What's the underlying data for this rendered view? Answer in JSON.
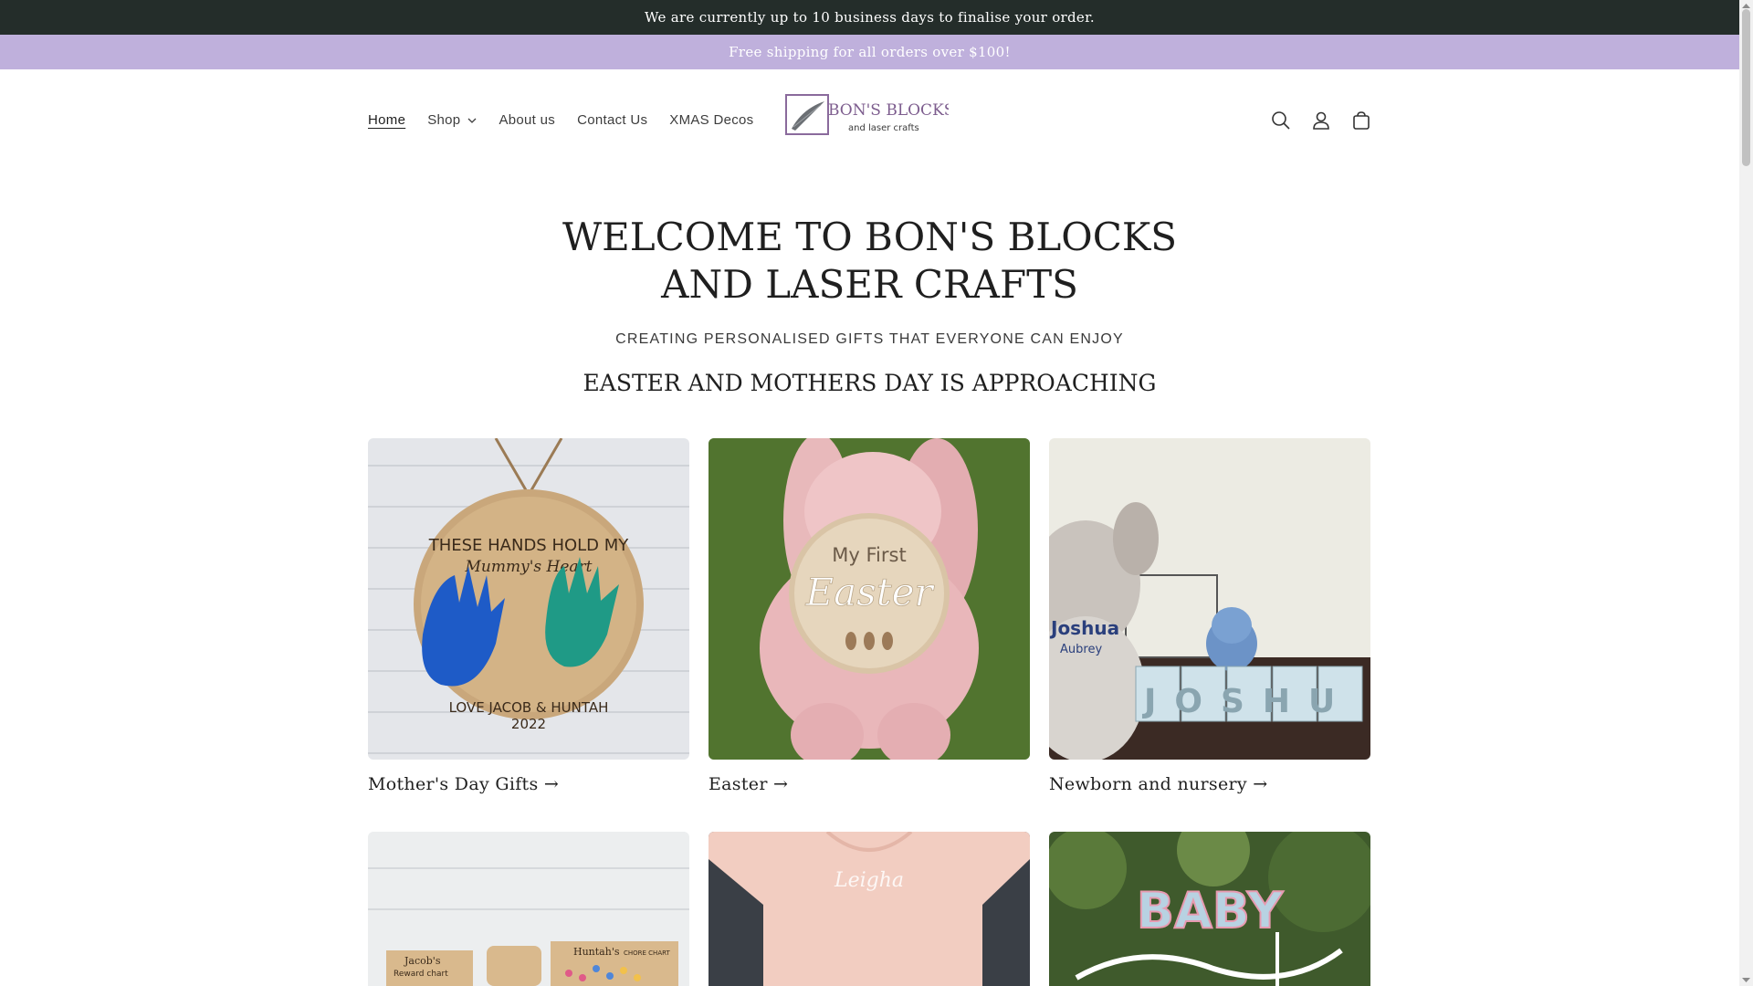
{
  "announcement": {
    "primary": "We are currently up to 10 business days to finalise your order.",
    "secondary": "Free shipping for all orders over $100!"
  },
  "header": {
    "nav": [
      {
        "label": "Home",
        "active": true
      },
      {
        "label": "Shop",
        "has_dropdown": true
      },
      {
        "label": "About us"
      },
      {
        "label": "Contact Us"
      },
      {
        "label": "XMAS Decos"
      }
    ],
    "logo": {
      "line1": "BON'S BLOCKS",
      "line2": "and laser crafts"
    },
    "icons": [
      "search-icon",
      "account-icon",
      "cart-icon"
    ]
  },
  "hero": {
    "title": "WELCOME TO BON'S BLOCKS AND LASER CRAFTS",
    "subtitle": "CREATING PERSONALISED GIFTS THAT EVERYONE CAN ENJOY",
    "heading": "EASTER AND MOTHERS DAY IS APPROACHING"
  },
  "collections": [
    {
      "label": "Mother's Day Gifts →",
      "image_text": [
        "THESE HANDS HOLD MY",
        "Mummy's Heart",
        "LOVE JACOB & HUNTAH",
        "2022"
      ]
    },
    {
      "label": "Easter →",
      "image_text": [
        "My First",
        "Easter"
      ]
    },
    {
      "label": "Newborn and nursery →",
      "image_text": [
        "Joshua",
        "Aubrey",
        "JOSHU"
      ]
    },
    {
      "label": "",
      "image_text": [
        "Jacob's",
        "Reward chart",
        "Huntah's",
        "CHORE CHART"
      ]
    },
    {
      "label": "",
      "image_text": [
        "Leigha"
      ]
    },
    {
      "label": "",
      "image_text": [
        "BABY"
      ]
    }
  ],
  "colors": {
    "announcement_dark": "#242d2a",
    "announcement_lilac": "#bfb0dc",
    "text": "#1f1f1f"
  }
}
